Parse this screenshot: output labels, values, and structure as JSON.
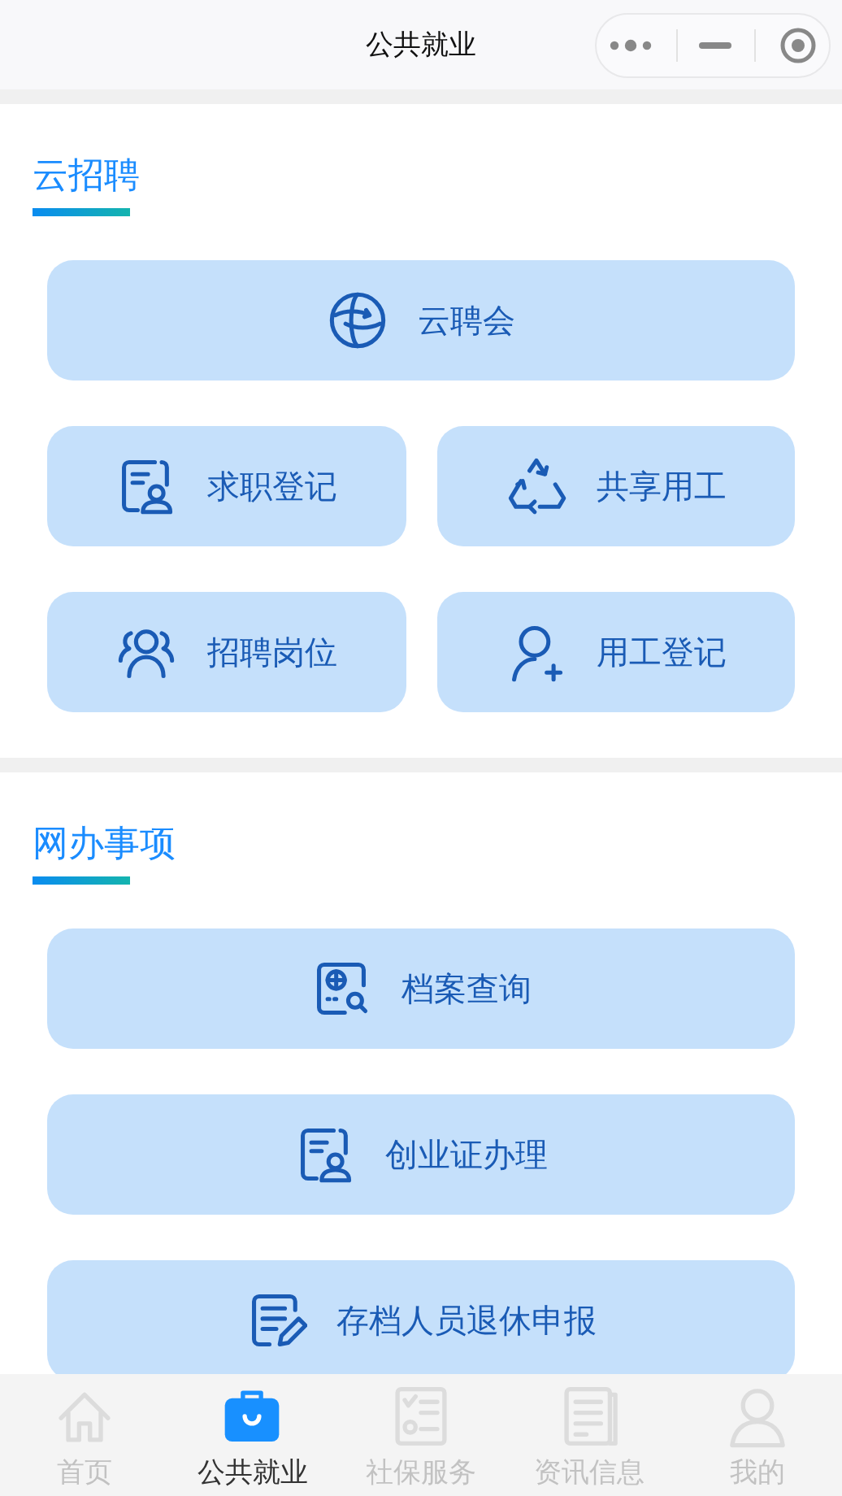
{
  "header": {
    "title": "公共就业"
  },
  "sections": [
    {
      "title": "云招聘",
      "items": [
        {
          "label": "云聘会",
          "kind": "wide"
        },
        {
          "label": "求职登记",
          "kind": "half"
        },
        {
          "label": "共享用工",
          "kind": "half"
        },
        {
          "label": "招聘岗位",
          "kind": "half"
        },
        {
          "label": "用工登记",
          "kind": "half"
        }
      ]
    },
    {
      "title": "网办事项",
      "items": [
        {
          "label": "档案查询",
          "kind": "wide"
        },
        {
          "label": "创业证办理",
          "kind": "wide"
        },
        {
          "label": "存档人员退休申报",
          "kind": "wide"
        }
      ]
    }
  ],
  "tab_bar": [
    {
      "label": "首页",
      "selected": false
    },
    {
      "label": "公共就业",
      "selected": true
    },
    {
      "label": "社保服务",
      "selected": false
    },
    {
      "label": "资讯信息",
      "selected": false
    },
    {
      "label": "我的",
      "selected": false
    }
  ]
}
